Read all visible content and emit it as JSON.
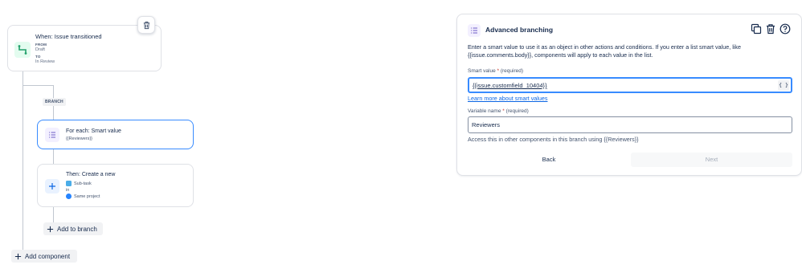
{
  "trigger": {
    "title": "When: Issue transitioned",
    "from_label": "FROM",
    "from_value": "Draft",
    "to_label": "TO",
    "to_value": "In Review"
  },
  "branch": {
    "badge": "BRANCH",
    "foreach_title": "For each: Smart value",
    "foreach_value": "{{Reviewers}}"
  },
  "action": {
    "title": "Then: Create a new",
    "issue_type": "Sub-task",
    "in_label": "in",
    "project": "Same project"
  },
  "buttons": {
    "add_to_branch": "Add to branch",
    "add_component": "Add component",
    "back": "Back",
    "next": "Next"
  },
  "panel": {
    "title": "Advanced branching",
    "description": "Enter a smart value to use it as an object in other actions and conditions. If you enter a list smart value, like {{issue.comments.body}}, components will apply to each value in the list.",
    "smart_value_label": "Smart value",
    "required_mark": "*",
    "required_text": "(required)",
    "smart_value": "{{issue.customfield_10404}}",
    "brace_button": "{ }",
    "learn_more": "Learn more about smart values",
    "variable_name_label": "Variable name",
    "variable_name": "Reviewers",
    "helper_text": "Access this in other components in this branch using {{Reviewers}}"
  },
  "colors": {
    "accent": "#388bff",
    "link": "#0c66e4",
    "trigger_icon": "#22a06b",
    "branch_icon": "#6e5dc6",
    "required": "#c9372c"
  },
  "icons": {
    "trigger": "transition-icon",
    "branch": "list-icon",
    "add": "plus-icon",
    "delete": "trash-icon",
    "duplicate": "copy-icon",
    "help": "help-icon"
  }
}
